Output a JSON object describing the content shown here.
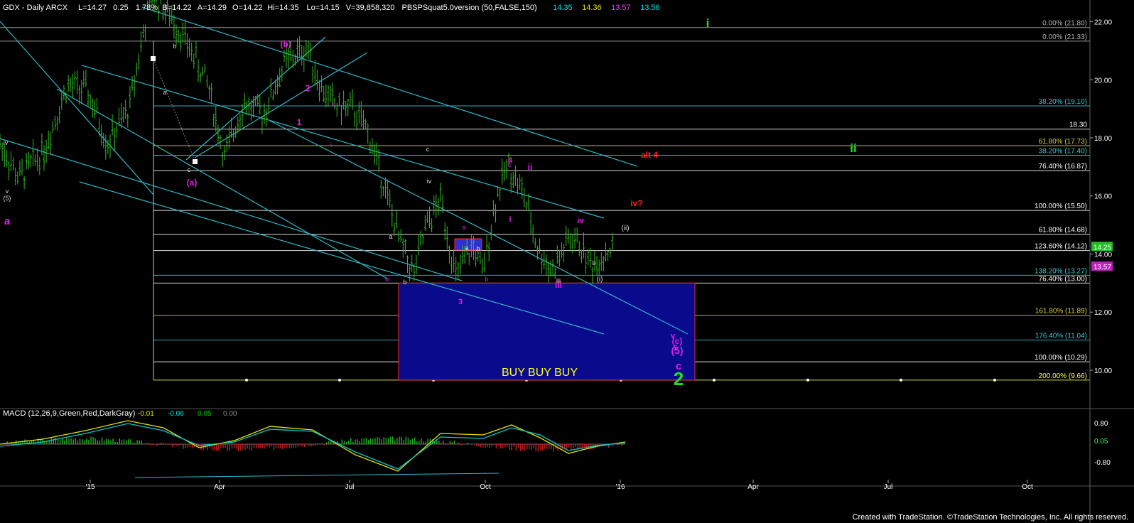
{
  "window": {
    "header_symbol": "GDX - Daily  ARCX",
    "header_fields": [
      "L=14.27",
      "0.25",
      "1.78%",
      "B=14.22",
      "A=14.29",
      "O=14.22",
      "Hi=14.35",
      "Lo=14.15",
      "V=39,858,320",
      "PBSPSquat5.0version (50,FALSE,150)"
    ],
    "header_values": [
      {
        "text": "14.35",
        "color": "#00e5e5"
      },
      {
        "text": "14.36",
        "color": "#e5e500"
      },
      {
        "text": "13.57",
        "color": "#ff33ff"
      },
      {
        "text": "13.56",
        "color": "#00e5e5"
      }
    ],
    "macd_header": "MACD (12,26,9,Green,Red,DarkGray)",
    "macd_values": [
      {
        "text": "-0.01",
        "color": "#e5e500"
      },
      {
        "text": "-0.06",
        "color": "#00e5e5"
      },
      {
        "text": "0.05",
        "color": "#00cc00"
      },
      {
        "text": "0.00",
        "color": "#888888"
      }
    ],
    "footer": "Created with TradeStation. ©TradeStation Technologies, Inc. All rights reserved."
  },
  "colors": {
    "background": "#000000",
    "candles": "#33bb22",
    "channel": "#2fb8c8",
    "fib_line": "#c8c8c8",
    "target_box": "#0a0a8c",
    "target_border": "#ff2222",
    "wave_magenta": "#e020e0",
    "wave_green": "#20e020",
    "wave_red": "#ff2222"
  },
  "chart_data": {
    "type": "candlestick",
    "symbol": "GDX",
    "x_axis_labels": [
      "'15",
      "Apr",
      "Jul",
      "Oct",
      "'16",
      "Apr",
      "Jul",
      "Oct"
    ],
    "y_ticks": [
      10.0,
      12.0,
      14.0,
      16.0,
      18.0,
      20.0,
      22.0
    ],
    "ylim": [
      9.0,
      23.0
    ],
    "last_price": "14.25",
    "last_price_tag": "13.57",
    "fib_levels": [
      {
        "label": "0.00% (21.80)",
        "value": 21.8,
        "color": "#b0b0b0"
      },
      {
        "label": "0.00% (21.33)",
        "value": 21.33,
        "color": "#b0b0b0"
      },
      {
        "label": "38.20% (19.10)",
        "value": 19.1,
        "color": "#3cc8d8"
      },
      {
        "label": "18.30",
        "value": 18.3,
        "color": "#ffffff"
      },
      {
        "label": "61.80% (17.73)",
        "value": 17.73,
        "color": "#d8d040"
      },
      {
        "label": "38.20% (17.40)",
        "value": 17.4,
        "color": "#3cc8d8"
      },
      {
        "label": "76.40% (16.87)",
        "value": 16.87,
        "color": "#ffffff"
      },
      {
        "label": "100.00% (15.50)",
        "value": 15.5,
        "color": "#ffffff"
      },
      {
        "label": "61.80% (14.68)",
        "value": 14.68,
        "color": "#ffffff"
      },
      {
        "label": "123.60% (14.12)",
        "value": 14.12,
        "color": "#ffffff"
      },
      {
        "label": "138.20% (13.27)",
        "value": 13.27,
        "color": "#3cc8d8"
      },
      {
        "label": "76.40% (13.00)",
        "value": 13.0,
        "color": "#ffffff"
      },
      {
        "label": "161.80% (11.89)",
        "value": 11.89,
        "color": "#d8d040"
      },
      {
        "label": "176.40% (11.04)",
        "value": 11.04,
        "color": "#3cc8d8"
      },
      {
        "label": "100.00% (10.29)",
        "value": 10.29,
        "color": "#ffffff"
      },
      {
        "label": "200.00% (9.66)",
        "value": 9.66,
        "color": "#ffff40"
      }
    ],
    "target_zone": {
      "top": 13.0,
      "bottom": 9.66,
      "label": "BUY  BUY  BUY"
    },
    "price_path": [
      [
        "2014-10-01",
        17.8
      ],
      [
        "2014-10-15",
        16.6
      ],
      [
        "2014-11-03",
        17.6
      ],
      [
        "2014-11-20",
        19.8
      ],
      [
        "2014-12-05",
        19.6
      ],
      [
        "2014-12-20",
        17.8
      ],
      [
        "2015-01-05",
        19.0
      ],
      [
        "2015-01-15",
        21.5
      ],
      [
        "2015-01-22",
        22.9
      ],
      [
        "2015-02-05",
        22.2
      ],
      [
        "2015-02-20",
        21.0
      ],
      [
        "2015-03-05",
        19.8
      ],
      [
        "2015-03-17",
        17.3
      ],
      [
        "2015-03-31",
        19.2
      ],
      [
        "2015-04-15",
        18.8
      ],
      [
        "2015-05-01",
        20.6
      ],
      [
        "2015-05-18",
        21.1
      ],
      [
        "2015-05-28",
        19.7
      ],
      [
        "2015-06-08",
        19.1
      ],
      [
        "2015-06-20",
        19.0
      ],
      [
        "2015-07-01",
        18.3
      ],
      [
        "2015-07-15",
        16.2
      ],
      [
        "2015-07-24",
        14.6
      ],
      [
        "2015-08-05",
        13.3
      ],
      [
        "2015-08-13",
        14.8
      ],
      [
        "2015-08-25",
        15.9
      ],
      [
        "2015-09-05",
        13.2
      ],
      [
        "2015-09-18",
        14.3
      ],
      [
        "2015-09-25",
        13.3
      ],
      [
        "2015-10-05",
        15.9
      ],
      [
        "2015-10-14",
        17.1
      ],
      [
        "2015-10-26",
        16.0
      ],
      [
        "2015-11-05",
        14.2
      ],
      [
        "2015-11-16",
        13.4
      ],
      [
        "2015-11-28",
        14.5
      ],
      [
        "2015-12-05",
        14.4
      ],
      [
        "2015-12-15",
        13.6
      ],
      [
        "2015-12-31",
        14.25
      ]
    ],
    "macd_ticks": [
      "0.80",
      "0.05",
      "-0.80"
    ],
    "wave_labels": [
      {
        "text": "a",
        "color": "#e020e0"
      },
      {
        "text": "(b)",
        "color": "#e020e0"
      },
      {
        "text": "(a)",
        "color": "#e020e0"
      },
      {
        "text": "2",
        "color": "#e020e0"
      },
      {
        "text": "1",
        "color": "#e020e0"
      },
      {
        "text": "i",
        "color": "#e020e0"
      },
      {
        "text": "ii",
        "color": "#e020e0"
      },
      {
        "text": "iii",
        "color": "#e020e0"
      },
      {
        "text": "3",
        "color": "#e020e0"
      },
      {
        "text": "a",
        "color": "#e020e0"
      },
      {
        "text": "b",
        "color": "#e020e0"
      },
      {
        "text": "4",
        "color": "#e020e0"
      },
      {
        "text": "c",
        "color": "#e020e0"
      },
      {
        "text": "i",
        "color": "#e020e0"
      },
      {
        "text": "ii",
        "color": "#e020e0"
      },
      {
        "text": "iii",
        "color": "#e020e0"
      },
      {
        "text": "iv",
        "color": "#e020e0"
      },
      {
        "text": "v",
        "color": "#e020e0"
      },
      {
        "text": "5",
        "color": "#e020e0"
      },
      {
        "text": "(c)",
        "color": "#e020e0"
      },
      {
        "text": "(5)",
        "color": "#e020e0"
      },
      {
        "text": "c",
        "color": "#e020e0"
      },
      {
        "text": "2",
        "color": "#20e020"
      },
      {
        "text": "i",
        "color": "#20e020"
      },
      {
        "text": "ii",
        "color": "#20e020"
      },
      {
        "text": "alt 4",
        "color": "#ff2222"
      },
      {
        "text": "iv?",
        "color": "#ff2222"
      },
      {
        "text": "(ii)",
        "color": "#dddddd"
      },
      {
        "text": "(i)",
        "color": "#dddddd"
      },
      {
        "text": "iv",
        "color": "#dddddd"
      },
      {
        "text": "v",
        "color": "#dddddd"
      },
      {
        "text": "(5)",
        "color": "#dddddd"
      },
      {
        "text": "b",
        "color": "#dddddd"
      },
      {
        "text": "a",
        "color": "#dddddd"
      },
      {
        "text": "c",
        "color": "#dddddd"
      },
      {
        "text": "a",
        "color": "#dddddd"
      },
      {
        "text": "b",
        "color": "#dddddd"
      },
      {
        "text": "c",
        "color": "#dddddd"
      },
      {
        "text": "iv",
        "color": "#dddddd"
      },
      {
        "text": "a",
        "color": "#dddddd"
      },
      {
        "text": "b",
        "color": "#dddddd"
      },
      {
        "text": "iii",
        "color": "#dddddd"
      },
      {
        "text": "b",
        "color": "#dddddd"
      }
    ]
  }
}
